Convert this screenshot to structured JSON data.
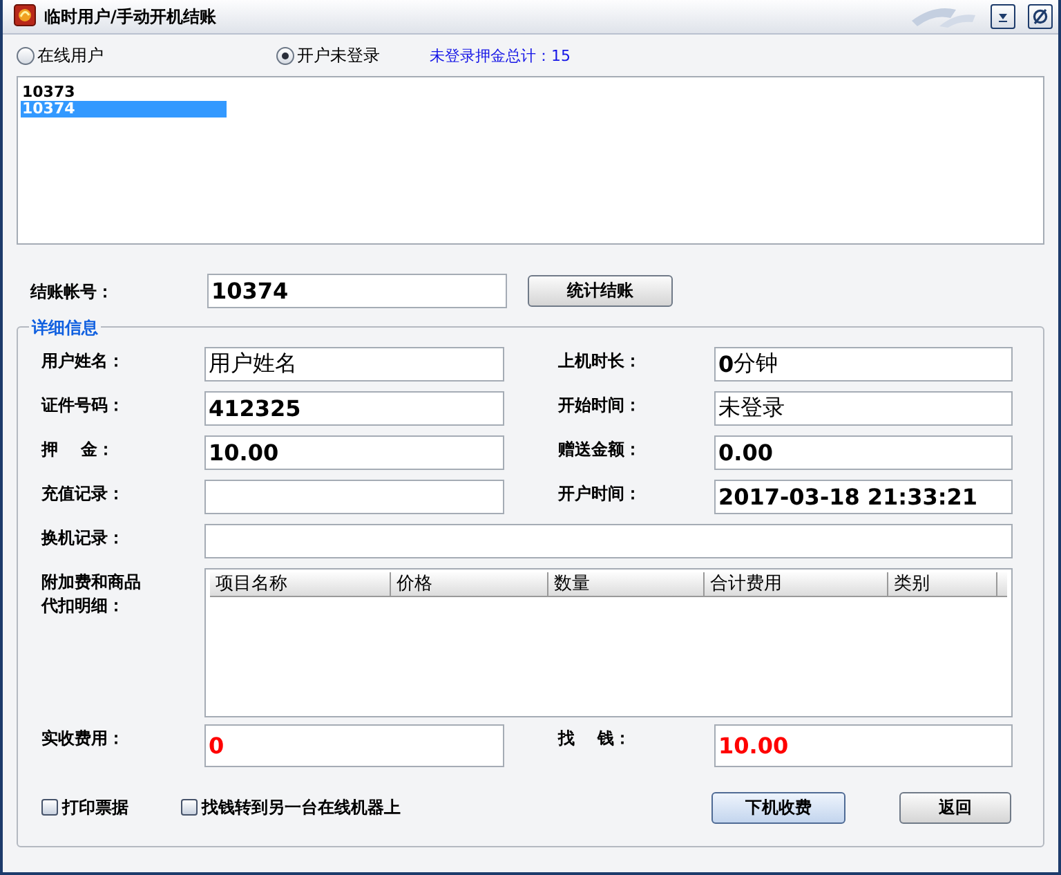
{
  "window": {
    "title": "临时用户/手动开机结账"
  },
  "radios": [
    {
      "label": "在线用户",
      "selected": false
    },
    {
      "label": "开户未登录",
      "selected": true
    }
  ],
  "deposit_total": "未登录押金总计：15",
  "accounts": [
    {
      "text": "10373",
      "selected": false
    },
    {
      "text": "10374",
      "selected": true
    }
  ],
  "checkout_account": {
    "label": "结账帐号：",
    "value": "10374",
    "bold": true
  },
  "stat_button": "统计结账",
  "details": {
    "legend": "详细信息",
    "fields": [
      {
        "kind": "half",
        "label": "用户姓名：",
        "value": "用户姓名",
        "bold": false
      },
      {
        "kind": "half",
        "label": "上机时长：",
        "value": "**0**分钟",
        "bold": false
      },
      {
        "kind": "half",
        "label": "证件号码：",
        "value": "412325",
        "bold": true
      },
      {
        "kind": "half",
        "label": "开始时间：",
        "value": "未登录",
        "bold": false
      },
      {
        "kind": "half",
        "label": "押    金：",
        "value": "10.00",
        "bold": true
      },
      {
        "kind": "half",
        "label": "赠送金额：",
        "value": "0.00",
        "bold": true
      },
      {
        "kind": "half",
        "label": "充值记录："
      },
      {
        "kind": "half",
        "label": "开户时间：",
        "value": "2017-03-18 21:33:21",
        "bold": true
      },
      {
        "kind": "wide",
        "label": "换机记录："
      }
    ],
    "table": {
      "label": "附加费和商品代扣明细：",
      "columns": [
        "项目名称",
        "价格",
        "数量",
        "合计费用",
        "类别"
      ]
    },
    "charges": [
      {
        "label": "实收费用：",
        "value": "0",
        "alert": true
      },
      {
        "label": "找    钱：",
        "value": "10.00",
        "alert": true
      }
    ],
    "checkboxes": [
      {
        "label": "打印票据",
        "checked": false
      },
      {
        "label": "找钱转到另一台在线机器上",
        "checked": false
      }
    ],
    "buttons": [
      {
        "label": "下机收费",
        "default": true
      },
      {
        "label": "返回",
        "default": false
      }
    ]
  }
}
